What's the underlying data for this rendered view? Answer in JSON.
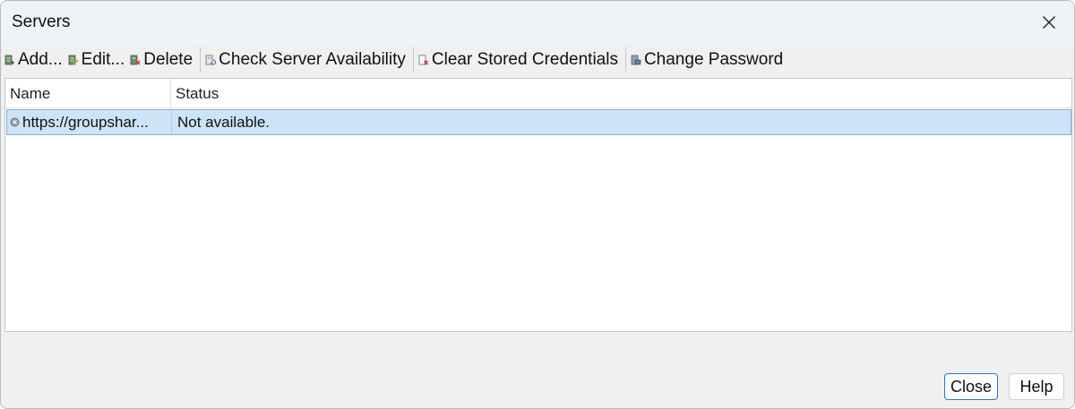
{
  "window": {
    "title": "Servers"
  },
  "toolbar": {
    "items": [
      {
        "label": "Add...",
        "icon": "add-server-icon"
      },
      {
        "label": "Edit...",
        "icon": "edit-server-icon"
      },
      {
        "label": "Delete",
        "icon": "delete-server-icon"
      },
      {
        "label": "Check Server Availability",
        "icon": "check-availability-icon"
      },
      {
        "label": "Clear Stored Credentials",
        "icon": "clear-credentials-icon"
      },
      {
        "label": "Change Password",
        "icon": "change-password-icon"
      }
    ]
  },
  "list": {
    "columns": [
      "Name",
      "Status"
    ],
    "rows": [
      {
        "name": "https://groupshar...",
        "status": "Not available.",
        "icon": "server-unavailable-icon",
        "selected": true
      }
    ]
  },
  "buttons": {
    "close": "Close",
    "help": "Help"
  },
  "colors": {
    "selection_bg": "#cce4f7",
    "selection_border": "#7fb0da",
    "accent": "#2b78c5"
  }
}
